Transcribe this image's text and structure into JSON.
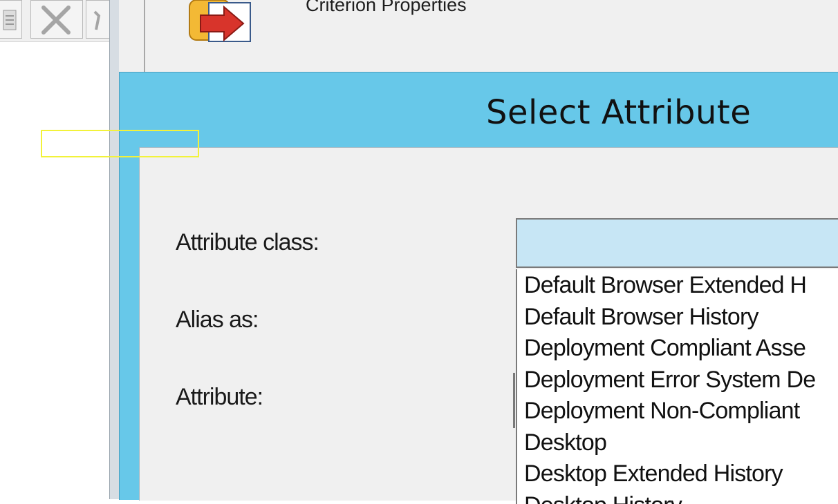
{
  "background_window": {
    "title": "Criterion Properties"
  },
  "dialog": {
    "title": "Select Attribute",
    "labels": {
      "attribute_class": "Attribute class:",
      "alias_as": "Alias as:",
      "attribute": "Attribute:"
    },
    "attribute_class_value": "",
    "dropdown_items": [
      "Default Browser Extended H",
      "Default Browser History",
      "Deployment Compliant Asse",
      "Deployment Error System De",
      "Deployment Non-Compliant",
      "Desktop",
      "Desktop Extended History",
      "Desktop History"
    ]
  },
  "colors": {
    "dialog_frame": "#67c8e9",
    "combo_fill": "#c7e6f5",
    "highlight": "#f2f23a"
  }
}
